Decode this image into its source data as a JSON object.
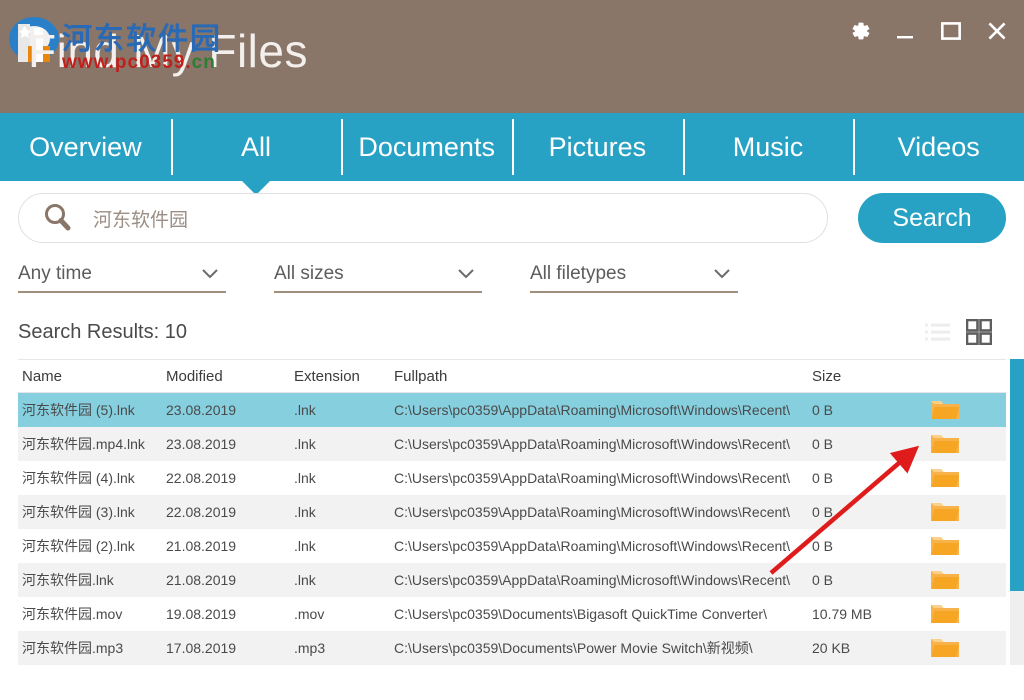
{
  "window": {
    "title": "Find My Files",
    "watermark_cn": "河东软件园",
    "watermark_url_red": "www.pc0359.",
    "watermark_url_green": "cn",
    "controls": {
      "settings": "gear-icon",
      "minimize": "minimize-icon",
      "maximize": "maximize-icon",
      "close": "close-icon"
    },
    "colors": {
      "titlebar": "#8a7669",
      "accent": "#27a2c4",
      "selection": "#86cfdf",
      "folder": "#f5a623",
      "annotation": "#e01b1b"
    }
  },
  "tabs": [
    {
      "label": "Overview",
      "active": false
    },
    {
      "label": "All",
      "active": true
    },
    {
      "label": "Documents",
      "active": false
    },
    {
      "label": "Pictures",
      "active": false
    },
    {
      "label": "Music",
      "active": false
    },
    {
      "label": "Videos",
      "active": false
    }
  ],
  "search": {
    "icon": "magnifier-icon",
    "value": "河东软件园",
    "placeholder": "河东软件园",
    "button_label": "Search"
  },
  "filters": [
    {
      "label": "Any time",
      "name": "time-filter"
    },
    {
      "label": "All sizes",
      "name": "size-filter"
    },
    {
      "label": "All filetypes",
      "name": "filetype-filter"
    }
  ],
  "results": {
    "label": "Search Results:  10",
    "count": "10",
    "view_list_icon": "list-view-icon",
    "view_grid_icon": "grid-view-icon",
    "active_view": "grid"
  },
  "table": {
    "columns": [
      "Name",
      "Modified",
      "Extension",
      "Fullpath",
      "Size"
    ],
    "rows": [
      {
        "name": "河东软件园 (5).lnk",
        "modified": "23.08.2019",
        "extension": ".lnk",
        "fullpath": "C:\\Users\\pc0359\\AppData\\Roaming\\Microsoft\\Windows\\Recent\\",
        "size": "0 B",
        "selected": true
      },
      {
        "name": "河东软件园.mp4.lnk",
        "modified": "23.08.2019",
        "extension": ".lnk",
        "fullpath": "C:\\Users\\pc0359\\AppData\\Roaming\\Microsoft\\Windows\\Recent\\",
        "size": "0 B",
        "selected": false
      },
      {
        "name": "河东软件园 (4).lnk",
        "modified": "22.08.2019",
        "extension": ".lnk",
        "fullpath": "C:\\Users\\pc0359\\AppData\\Roaming\\Microsoft\\Windows\\Recent\\",
        "size": "0 B",
        "selected": false
      },
      {
        "name": "河东软件园 (3).lnk",
        "modified": "22.08.2019",
        "extension": ".lnk",
        "fullpath": "C:\\Users\\pc0359\\AppData\\Roaming\\Microsoft\\Windows\\Recent\\",
        "size": "0 B",
        "selected": false
      },
      {
        "name": "河东软件园 (2).lnk",
        "modified": "21.08.2019",
        "extension": ".lnk",
        "fullpath": "C:\\Users\\pc0359\\AppData\\Roaming\\Microsoft\\Windows\\Recent\\",
        "size": "0 B",
        "selected": false
      },
      {
        "name": "河东软件园.lnk",
        "modified": "21.08.2019",
        "extension": ".lnk",
        "fullpath": "C:\\Users\\pc0359\\AppData\\Roaming\\Microsoft\\Windows\\Recent\\",
        "size": "0 B",
        "selected": false
      },
      {
        "name": "河东软件园.mov",
        "modified": "19.08.2019",
        "extension": ".mov",
        "fullpath": "C:\\Users\\pc0359\\Documents\\Bigasoft QuickTime Converter\\",
        "size": "10.79 MB",
        "selected": false
      },
      {
        "name": "河东软件园.mp3",
        "modified": "17.08.2019",
        "extension": ".mp3",
        "fullpath": "C:\\Users\\pc0359\\Documents\\Power Movie Switch\\新视频\\",
        "size": "20 KB",
        "selected": false
      }
    ]
  }
}
